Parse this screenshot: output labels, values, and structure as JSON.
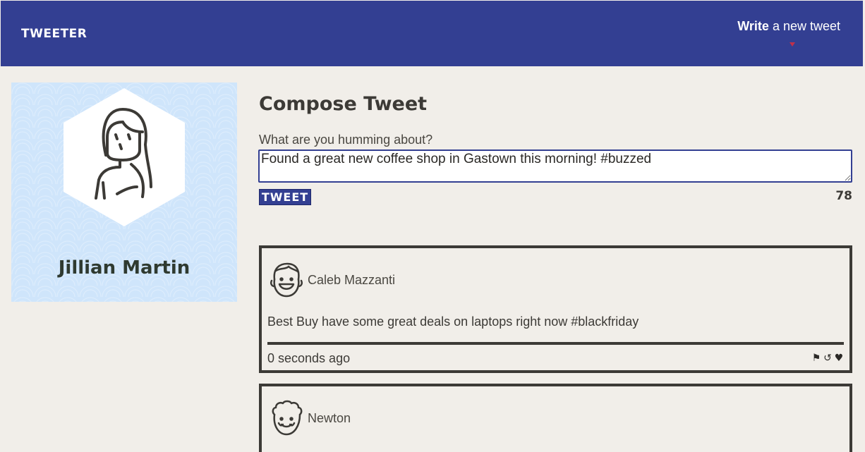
{
  "navbar": {
    "brand": "TWEETER",
    "write_bold": "Write",
    "write_rest": " a new tweet"
  },
  "profile": {
    "name": "Jillian Martin"
  },
  "compose": {
    "title": "Compose Tweet",
    "label": "What are you humming about?",
    "value": "Found a great new coffee shop in Gastown this morning! #buzzed",
    "button_label": "TWEET",
    "char_count": "78"
  },
  "tweets": [
    {
      "author": "Caleb Mazzanti",
      "body": "Best Buy have some great deals on laptops right now #blackfriday",
      "time": "0 seconds ago",
      "actions": [
        "flag-icon",
        "retweet-icon",
        "heart-icon"
      ]
    },
    {
      "author": "Newton"
    }
  ],
  "colors": {
    "navbar": "#333f92",
    "background": "#f1eee9",
    "profile_bg": "#cfe5fb",
    "text": "#3c3a36",
    "caret": "#c0304a"
  }
}
